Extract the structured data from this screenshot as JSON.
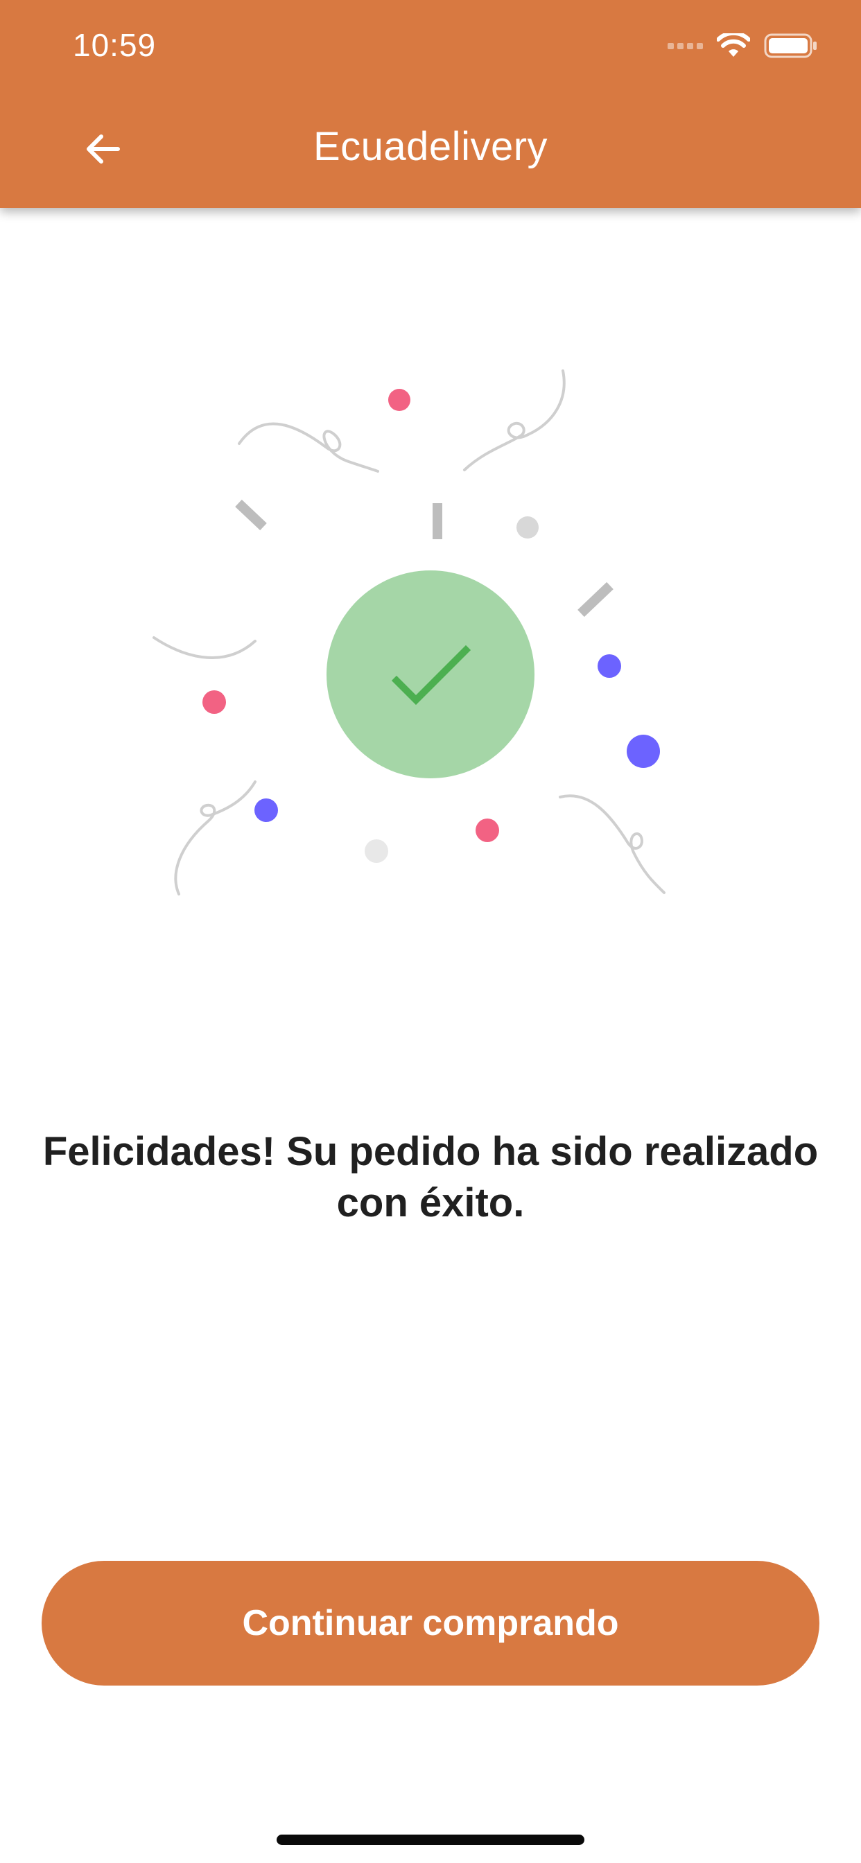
{
  "status_bar": {
    "time": "10:59",
    "icons": [
      "cellular-dots-icon",
      "wifi-icon",
      "battery-icon"
    ]
  },
  "header": {
    "title": "Ecuadelivery",
    "back_icon": "arrow-left-icon"
  },
  "illustration": {
    "icon": "checkmark-icon",
    "circle_color": "#A5D6A7",
    "check_color": "#4CAF50",
    "confetti_colors": [
      "#F26283",
      "#6C63FF",
      "#BDBDBD"
    ]
  },
  "success": {
    "message": "Felicidades! Su pedido ha sido realizado con éxito."
  },
  "actions": {
    "continue_label": "Continuar comprando"
  },
  "theme": {
    "accent": "#D87941"
  }
}
